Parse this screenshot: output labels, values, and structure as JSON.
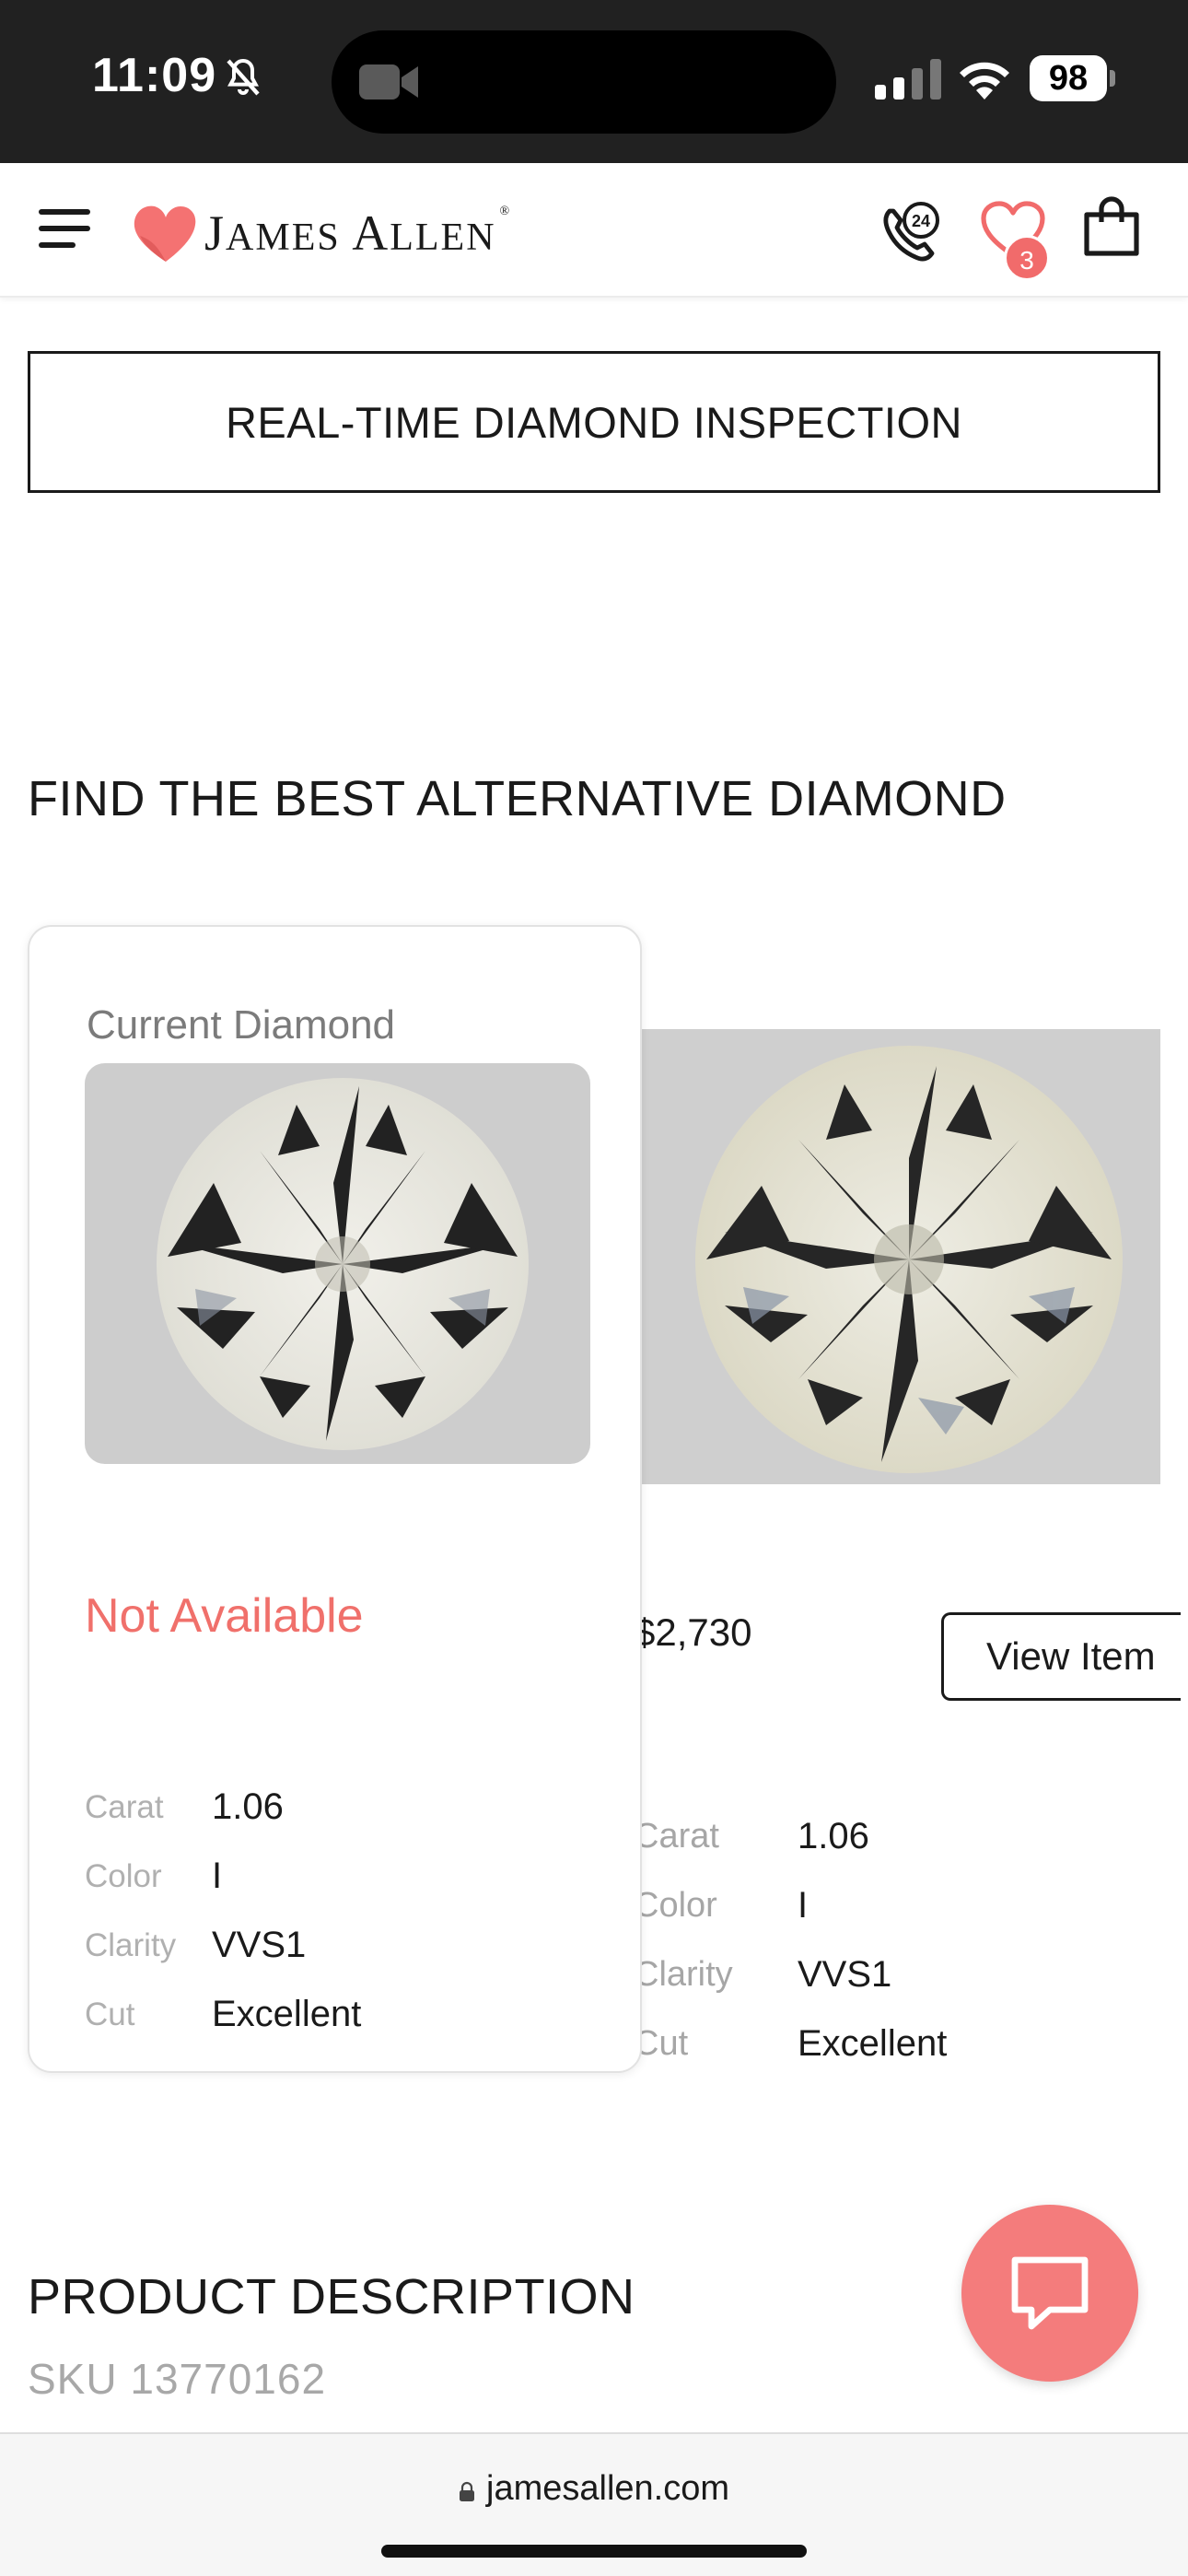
{
  "status_bar": {
    "time": "11:09",
    "battery": "98"
  },
  "header": {
    "brand_first": "J",
    "brand_first_rest": "AMES",
    "brand_second": "A",
    "brand_second_rest": "LLEN",
    "brand_mark": "®",
    "wishlist_count": "3",
    "phone_badge": "24"
  },
  "inspection_button": "REAL-TIME DIAMOND INSPECTION",
  "alternatives": {
    "title": "FIND THE BEST ALTERNATIVE DIAMOND",
    "current": {
      "label": "Current Diamond",
      "availability": "Not Available",
      "specs": [
        {
          "label": "Carat",
          "value": "1.06"
        },
        {
          "label": "Color",
          "value": "I"
        },
        {
          "label": "Clarity",
          "value": "VVS1"
        },
        {
          "label": "Cut",
          "value": "Excellent"
        }
      ]
    },
    "alternative": {
      "price": "$2,730",
      "view_button": "View Item",
      "specs": [
        {
          "label": "Carat",
          "value": "1.06"
        },
        {
          "label": "Color",
          "value": "I"
        },
        {
          "label": "Clarity",
          "value": "VVS1"
        },
        {
          "label": "Cut",
          "value": "Excellent"
        }
      ]
    }
  },
  "product_description": {
    "title": "PRODUCT DESCRIPTION",
    "sku": "SKU 13770162"
  },
  "browser": {
    "url": "jamesallen.com"
  },
  "colors": {
    "accent": "#f16b6b",
    "not_available": "#f0706b",
    "chat": "#f47c7c"
  },
  "icons": [
    "bell-slash-icon",
    "video-icon",
    "signal-icon",
    "wifi-icon",
    "menu-icon",
    "heart-logo-icon",
    "phone-24-icon",
    "heart-icon",
    "shopping-bag-icon",
    "chat-icon",
    "lock-icon"
  ]
}
